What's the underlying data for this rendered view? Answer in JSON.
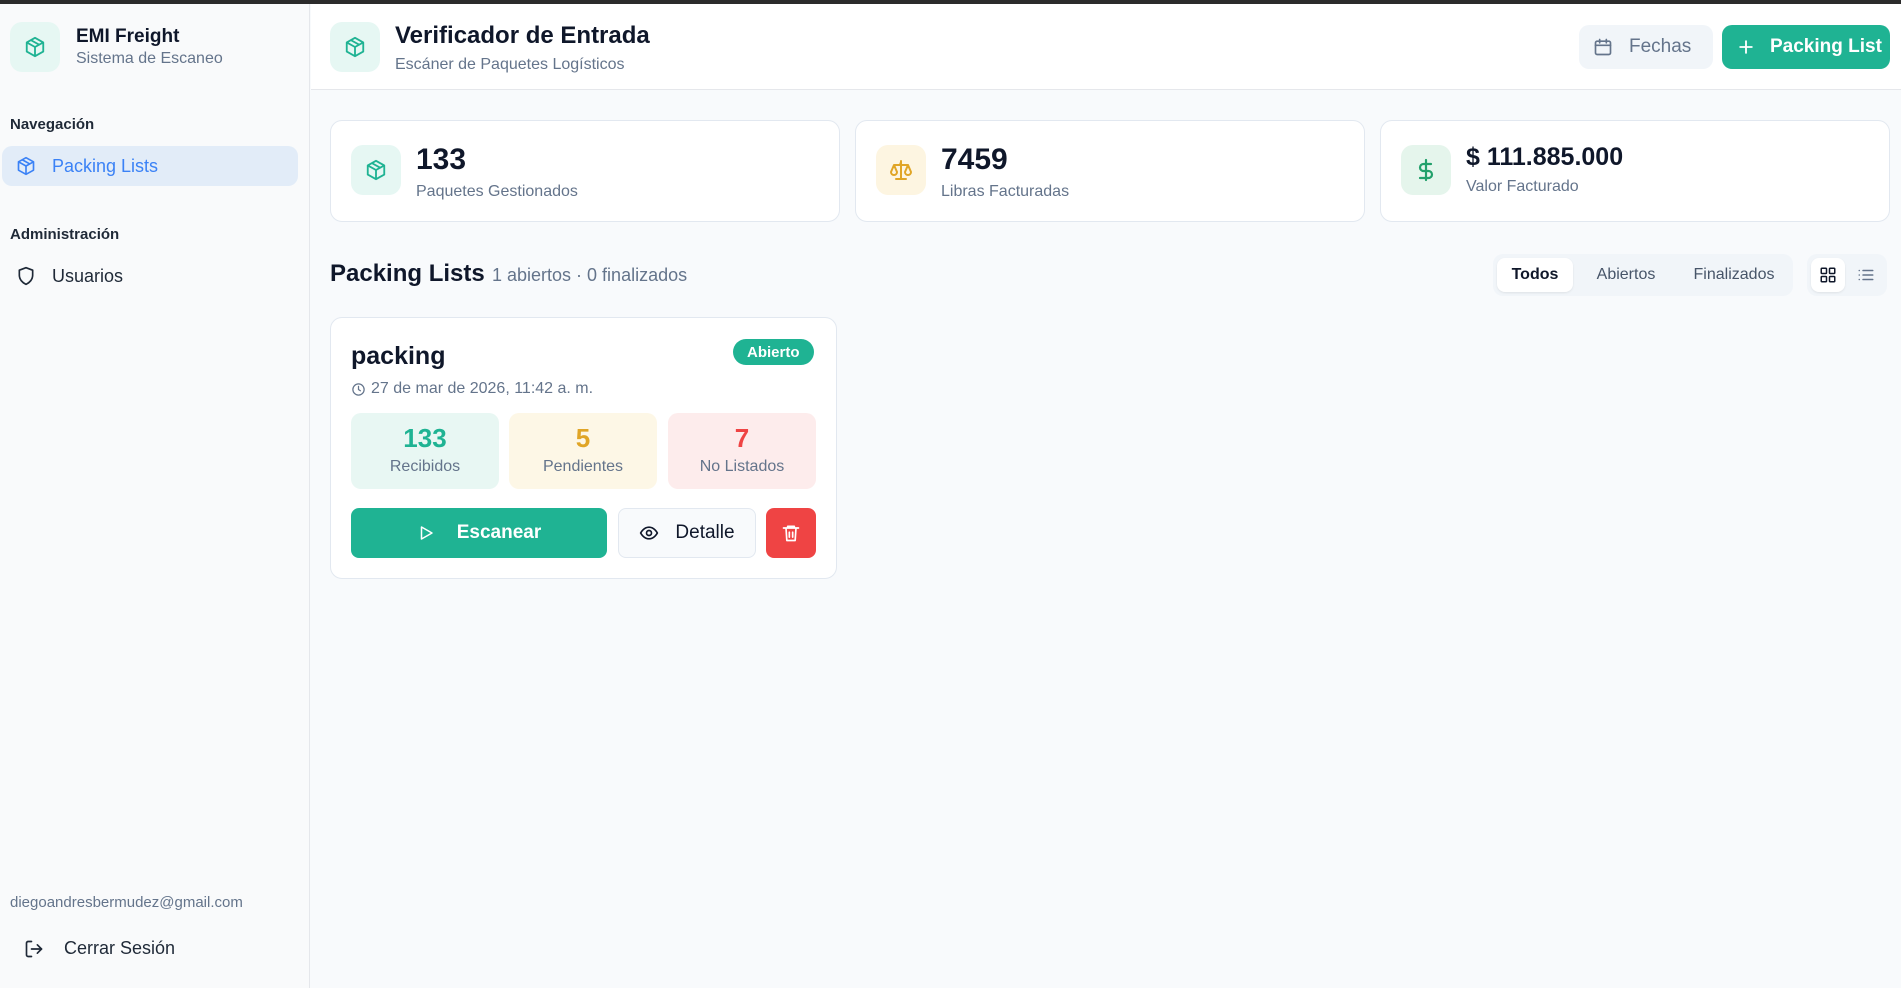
{
  "app": {
    "name": "EMI Freight",
    "subtitle": "Sistema de Escaneo"
  },
  "sidebar": {
    "sections": [
      {
        "title": "Navegación",
        "items": [
          {
            "label": "Packing Lists",
            "icon": "package-icon",
            "active": true
          }
        ]
      },
      {
        "title": "Administración",
        "items": [
          {
            "label": "Usuarios",
            "icon": "shield-icon",
            "active": false
          }
        ]
      }
    ],
    "user_email": "diegoandresbermudez@gmail.com",
    "logout_label": "Cerrar Sesión"
  },
  "header": {
    "title": "Verificador de Entrada",
    "subtitle": "Escáner de Paquetes Logísticos",
    "dates_button": "Fechas",
    "new_button": "Packing List"
  },
  "stats": [
    {
      "value": "133",
      "label": "Paquetes Gestionados",
      "icon": "package-icon",
      "color": "#1fb393"
    },
    {
      "value": "7459",
      "label": "Libras Facturadas",
      "icon": "scale-icon",
      "color": "#e0a526"
    },
    {
      "value": "$ 111.885.000",
      "label": "Valor Facturado",
      "icon": "dollar-icon",
      "color": "#22a06b"
    }
  ],
  "list_section": {
    "title": "Packing Lists",
    "summary": "1 abiertos · 0 finalizados",
    "filters": [
      "Todos",
      "Abiertos",
      "Finalizados"
    ],
    "active_filter": "Todos"
  },
  "packing_lists": [
    {
      "name": "packing",
      "status": "Abierto",
      "date": "27 de mar de 2026, 11:42 a. m.",
      "metrics": [
        {
          "value": "133",
          "label": "Recibidos",
          "color": "#1fb393"
        },
        {
          "value": "5",
          "label": "Pendientes",
          "color": "#e0a526"
        },
        {
          "value": "7",
          "label": "No Listados",
          "color": "#ef4444"
        }
      ],
      "scan_label": "Escanear",
      "detail_label": "Detalle"
    }
  ],
  "colors": {
    "primary": "#1fb393",
    "accent_blue": "#3b82f6",
    "danger": "#ef4444",
    "warning": "#e0a526"
  }
}
